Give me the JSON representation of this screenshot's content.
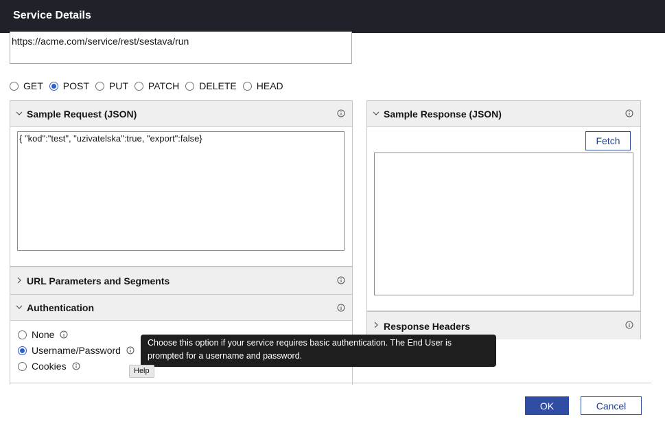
{
  "window": {
    "title": "Service Details"
  },
  "url": {
    "value": "https://acme.com/service/rest/sestava/run"
  },
  "methods": [
    {
      "label": "GET",
      "checked": false
    },
    {
      "label": "POST",
      "checked": true
    },
    {
      "label": "PUT",
      "checked": false
    },
    {
      "label": "PATCH",
      "checked": false
    },
    {
      "label": "DELETE",
      "checked": false
    },
    {
      "label": "HEAD",
      "checked": false
    }
  ],
  "sample_request": {
    "title": "Sample Request (JSON)",
    "body": "{  \"kod\":\"test\",  \"uzivatelska\":true,  \"export\":false}"
  },
  "url_params": {
    "title": "URL Parameters and Segments"
  },
  "authentication": {
    "title": "Authentication",
    "options": [
      {
        "label": "None",
        "checked": false
      },
      {
        "label": "Username/Password",
        "checked": true
      },
      {
        "label": "Cookies",
        "checked": false
      }
    ]
  },
  "sample_response": {
    "title": "Sample Response (JSON)",
    "fetch_label": "Fetch"
  },
  "response_headers": {
    "title": "Response Headers"
  },
  "tooltip": {
    "text": "Choose this option if your service requires basic authentication. The End User is prompted for a username and password."
  },
  "help_chip": {
    "label": "Help"
  },
  "footer": {
    "ok_label": "OK",
    "cancel_label": "Cancel"
  },
  "colors": {
    "titlebar": "#1f2329",
    "accent": "#2f4ea3",
    "radio_accent": "#2f5ccf",
    "panel_header": "#efefef"
  }
}
